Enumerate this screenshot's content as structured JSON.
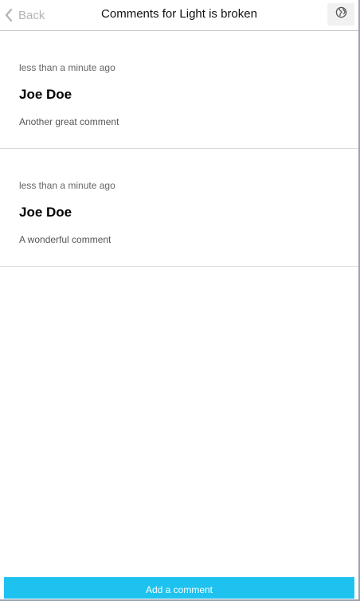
{
  "header": {
    "back_label": "Back",
    "title": "Comments for Light is broken",
    "globe_icon": "globe-icon",
    "back_icon": "chevron-left-icon"
  },
  "comments": [
    {
      "time": "less than a minute ago",
      "author": "Joe Doe",
      "text": "Another great comment"
    },
    {
      "time": "less than a minute ago",
      "author": "Joe Doe",
      "text": "A wonderful comment"
    }
  ],
  "footer": {
    "add_label": "Add a comment",
    "accent_color": "#1ec2ef"
  }
}
